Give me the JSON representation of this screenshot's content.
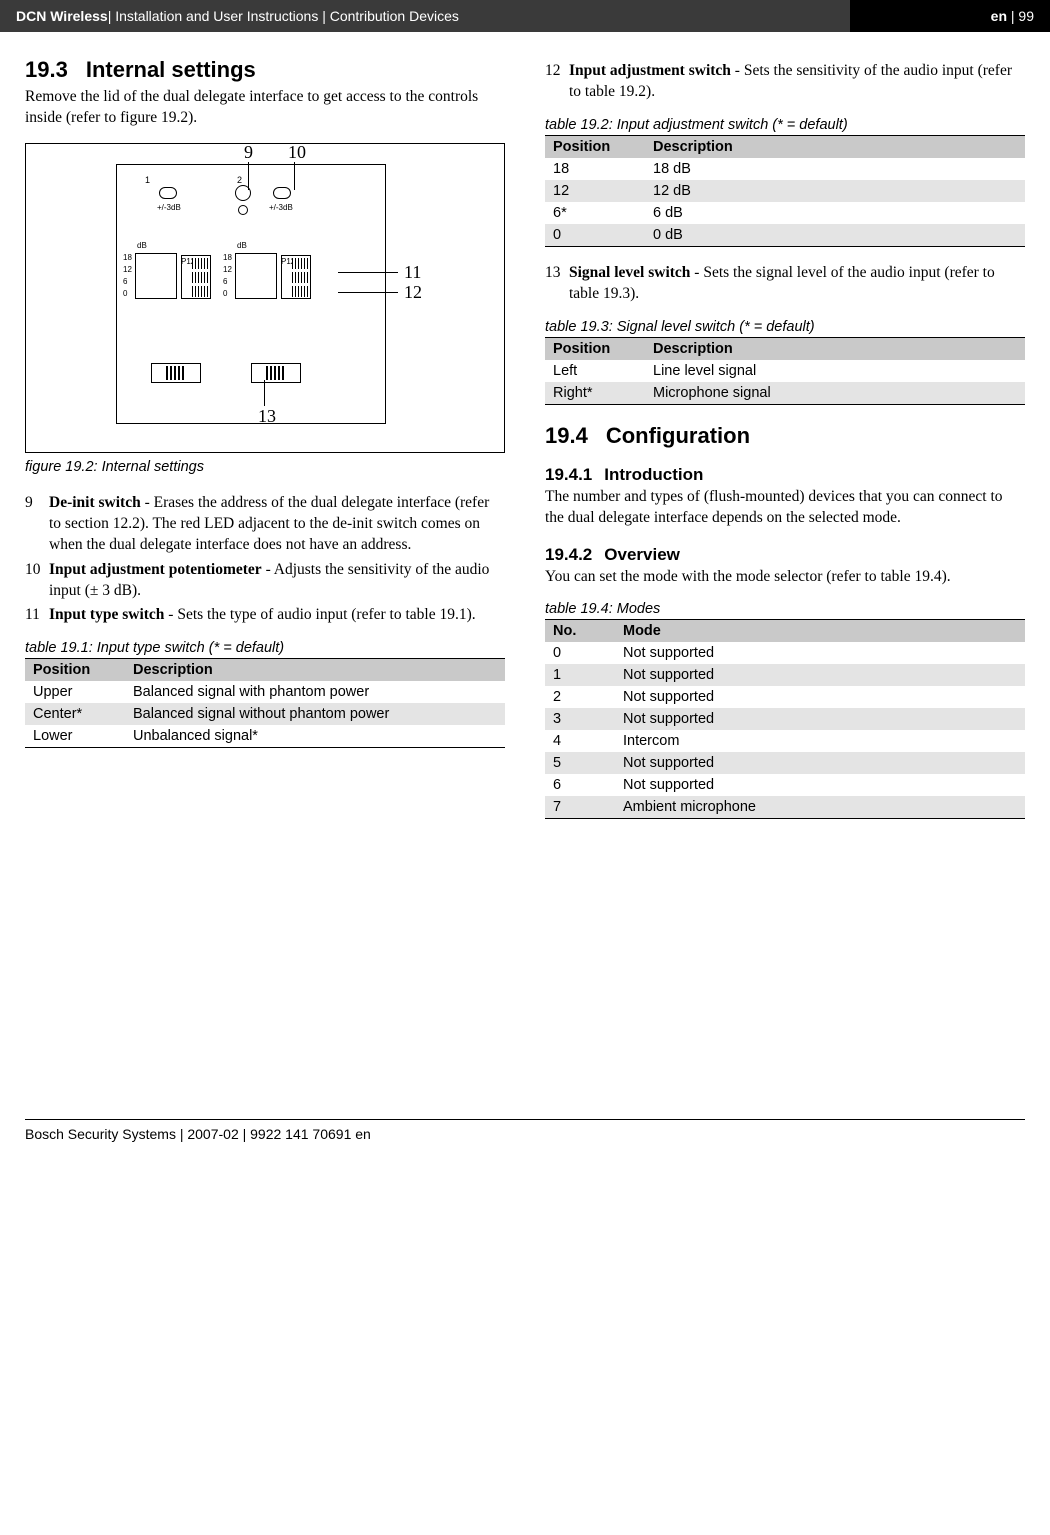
{
  "header": {
    "title_bold": "DCN Wireless",
    "title_rest": " | Installation and User Instructions | Contribution Devices",
    "lang": "en",
    "page": "99"
  },
  "left": {
    "section_num": "19.3",
    "section_title": "Internal settings",
    "intro": "Remove the lid of the dual delegate interface to get access to the controls inside (refer to figure 19.2).",
    "fig_caption": "figure 19.2: Internal settings",
    "fig_labels": {
      "c9": "9",
      "c10": "10",
      "c11": "11",
      "c12": "12",
      "c13": "13"
    },
    "pcb": {
      "n1": "1",
      "n2": "2",
      "pm3": "+/-3dB",
      "db": "dB",
      "s18": "18",
      "s12": "12",
      "s6": "6",
      "s0": "0",
      "p12": "P12"
    },
    "items": [
      {
        "num": "9",
        "term": "De-init switch",
        "desc": " - Erases the address of the dual delegate interface (refer to section 12.2). The red LED adjacent to the de-init switch comes on when the dual delegate interface does not have an address."
      },
      {
        "num": "10",
        "term": "Input adjustment potentiometer",
        "desc": " - Adjusts the sensitivity of the audio input (± 3 dB)."
      },
      {
        "num": "11",
        "term": "Input type switch",
        "desc": " - Sets the type of audio input (refer to table 19.1)."
      }
    ],
    "table191": {
      "caption": "table 19.1: Input type switch (* = default)",
      "head": [
        "Position",
        "Description"
      ],
      "rows": [
        [
          "Upper",
          "Balanced signal with phantom power"
        ],
        [
          "Center*",
          "Balanced signal without phantom power"
        ],
        [
          "Lower",
          "Unbalanced signal*"
        ]
      ]
    }
  },
  "right": {
    "items_a": [
      {
        "num": "12",
        "term": "Input adjustment switch",
        "desc": " - Sets the sensitivity of the audio input (refer to table 19.2)."
      }
    ],
    "table192": {
      "caption": "table 19.2: Input adjustment switch (* = default)",
      "head": [
        "Position",
        "Description"
      ],
      "rows": [
        [
          "18",
          "18 dB"
        ],
        [
          "12",
          "12 dB"
        ],
        [
          "6*",
          "6 dB"
        ],
        [
          "0",
          "0 dB"
        ]
      ]
    },
    "items_b": [
      {
        "num": "13",
        "term": "Signal level switch",
        "desc": " - Sets the signal level of the audio input (refer to table 19.3)."
      }
    ],
    "table193": {
      "caption": "table 19.3: Signal level switch (* = default)",
      "head": [
        "Position",
        "Description"
      ],
      "rows": [
        [
          "Left",
          "Line level signal"
        ],
        [
          "Right*",
          "Microphone signal"
        ]
      ]
    },
    "section2_num": "19.4",
    "section2_title": "Configuration",
    "sub1_num": "19.4.1",
    "sub1_title": "Introduction",
    "sub1_text": "The number and types of (flush-mounted) devices that you can connect to the dual delegate interface depends on the selected mode.",
    "sub2_num": "19.4.2",
    "sub2_title": "Overview",
    "sub2_text": "You can set the mode with the mode selector (refer to table 19.4).",
    "table194": {
      "caption": "table 19.4: Modes",
      "head": [
        "No.",
        "Mode"
      ],
      "rows": [
        [
          "0",
          "Not supported"
        ],
        [
          "1",
          "Not supported"
        ],
        [
          "2",
          "Not supported"
        ],
        [
          "3",
          "Not supported"
        ],
        [
          "4",
          "Intercom"
        ],
        [
          "5",
          "Not supported"
        ],
        [
          "6",
          "Not supported"
        ],
        [
          "7",
          "Ambient microphone"
        ]
      ]
    }
  },
  "footer": "Bosch Security Systems | 2007-02 | 9922 141 70691 en"
}
